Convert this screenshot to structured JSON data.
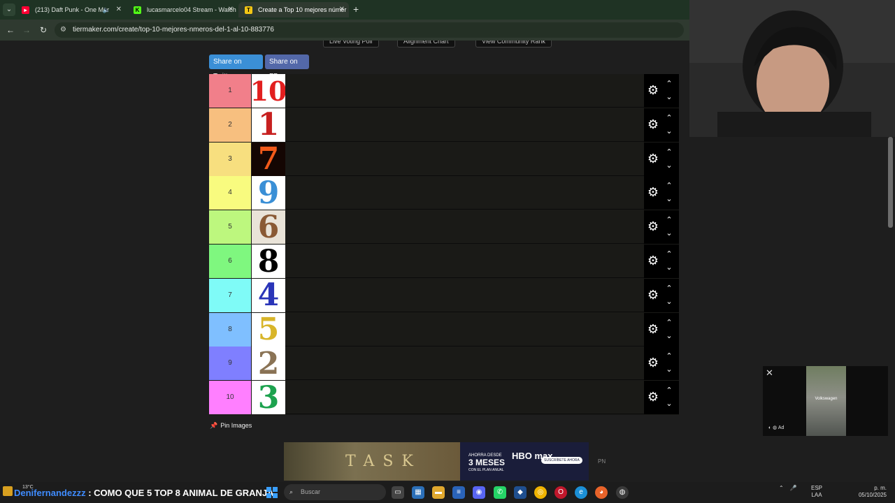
{
  "browser": {
    "tabs": [
      {
        "title": "(213) Daft Punk - One Mor",
        "icon": "youtube-icon"
      },
      {
        "title": "lucasmarcelo04 Stream - Watch",
        "icon": "kick-icon"
      },
      {
        "title": "Create a Top 10 mejores númer",
        "icon": "tiermaker-icon",
        "active": true
      }
    ],
    "url": "tiermaker.com/create/top-10-mejores-nmeros-del-1-al-10-883776"
  },
  "page": {
    "top_buttons": [
      "Live Voting Poll",
      "Alignment Chart",
      "View Community Rank"
    ],
    "share_twitter": "Share on Twitter",
    "share_fb": "Share on FB",
    "pin_images": "Pin Images",
    "tiers": [
      {
        "label": "1",
        "color": "#f17f8a",
        "item": "10",
        "item_color": "#e21f1f",
        "item_bg": "#ffffff"
      },
      {
        "label": "2",
        "color": "#f7bf7f",
        "item": "1",
        "item_color": "#c72020",
        "item_bg": "#ffffff"
      },
      {
        "label": "3",
        "color": "#f7df7f",
        "item": "7",
        "item_color": "#f25a1a",
        "item_bg": "#140603"
      },
      {
        "label": "4",
        "color": "#f8fb7f",
        "item": "9",
        "item_color": "#3a8fd6",
        "item_bg": "#ffffff"
      },
      {
        "label": "5",
        "color": "#bdf77e",
        "item": "6",
        "item_color": "#8a5a35",
        "item_bg": "#e9e3d8"
      },
      {
        "label": "6",
        "color": "#7ff77f",
        "item": "8",
        "item_color": "#000000",
        "item_bg": "#ffffff"
      },
      {
        "label": "7",
        "color": "#7ffbf7",
        "item": "4",
        "item_color": "#2a35b8",
        "item_bg": "#ffffff"
      },
      {
        "label": "8",
        "color": "#7fbfff",
        "item": "5",
        "item_color": "#d8b52a",
        "item_bg": "#ffffff"
      },
      {
        "label": "9",
        "color": "#7f7fff",
        "item": "2",
        "item_color": "#8a7355",
        "item_bg": "#ffffff"
      },
      {
        "label": "10",
        "color": "#ff7fff",
        "item": "3",
        "item_color": "#1ca24e",
        "item_bg": "#ffffff"
      }
    ]
  },
  "ads": {
    "video_label": "Ad",
    "video_brand": "Volkswagen",
    "banner_title": "TASK",
    "promo_line1": "AHORRA DESDE",
    "promo_line2": "3 MESES",
    "promo_line3": "CON EL PLAN ANUAL",
    "promo_brand": "HBO max",
    "promo_cta": "SUSCRÍBETE AHORA",
    "pn": "PN"
  },
  "taskbar": {
    "temp": "13°C",
    "chat_user": "Denifernandezzz",
    "chat_msg": " : COMO QUE 5 TOP 8 ANIMAL DE GRANJA",
    "search_placeholder": "Buscar",
    "lang1": "ESP",
    "lang2": "LAA",
    "time": "p. m.",
    "date": "05/10/2025"
  }
}
